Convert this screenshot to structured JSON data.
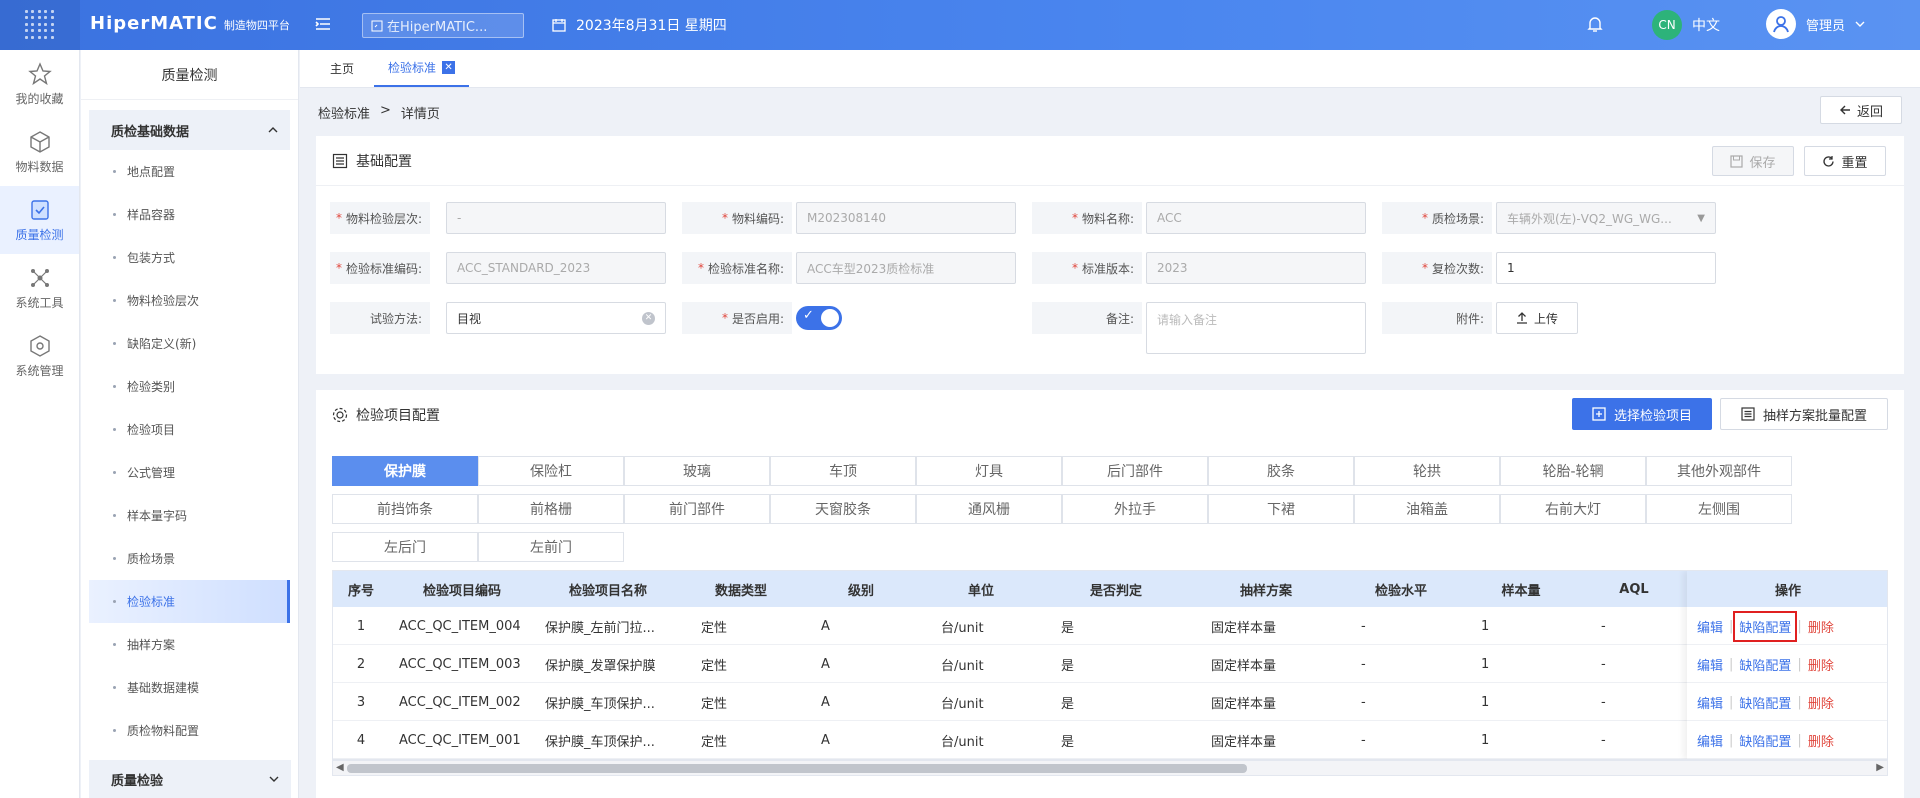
{
  "header": {
    "logo_text": "HiperMATIC",
    "logo_sub": "制造物四平台",
    "search_placeholder": "在HiperMATIC...",
    "date": "2023年8月31日 星期四",
    "lang_badge": "CN",
    "lang_label": "中文",
    "user_name": "管理员"
  },
  "rail": {
    "items": [
      {
        "label": "我的收藏",
        "icon": "star-icon"
      },
      {
        "label": "物料数据",
        "icon": "cube-icon"
      },
      {
        "label": "质量检测",
        "icon": "shield-check-icon"
      },
      {
        "label": "系统工具",
        "icon": "network-icon"
      },
      {
        "label": "系统管理",
        "icon": "gear-cube-icon"
      }
    ]
  },
  "sidebar": {
    "title": "质量检测",
    "group1": "质检基础数据",
    "items": [
      "地点配置",
      "样品容器",
      "包装方式",
      "物料检验层次",
      "缺陷定义(新)",
      "检验类别",
      "检验项目",
      "公式管理",
      "样本量字码",
      "质检场景",
      "检验标准",
      "抽样方案",
      "基础数据建模",
      "质检物料配置"
    ],
    "group2": "质量检验"
  },
  "tabs": {
    "home": "主页",
    "current": "检验标准"
  },
  "breadcrumb": {
    "parent": "检验标准",
    "sep": ">",
    "current": "详情页"
  },
  "back_label": "返回",
  "basic": {
    "title": "基础配置",
    "save_label": "保存",
    "reset_label": "重置",
    "fields": {
      "level_label": "物料检验层次:",
      "level_value": "-",
      "code_label": "物料编码:",
      "code_value": "M202308140",
      "name_label": "物料名称:",
      "name_value": "ACC",
      "scene_label": "质检场景:",
      "scene_value": "车辆外观(左)-VQ2_WG_WG...",
      "std_code_label": "检验标准编码:",
      "std_code_value": "ACC_STANDARD_2023",
      "std_name_label": "检验标准名称:",
      "std_name_value": "ACC车型2023质检标准",
      "version_label": "标准版本:",
      "version_value": "2023",
      "recheck_label": "复检次数:",
      "recheck_value": "1",
      "method_label": "试验方法:",
      "method_value": "目视",
      "enabled_label": "是否启用:",
      "remark_label": "备注:",
      "remark_placeholder": "请输入备注",
      "attach_label": "附件:",
      "upload_label": "上传"
    }
  },
  "items_config": {
    "title": "检验项目配置",
    "select_btn": "选择检验项目",
    "batch_btn": "抽样方案批量配置",
    "categories": [
      "保护膜",
      "保险杠",
      "玻璃",
      "车顶",
      "灯具",
      "后门部件",
      "胶条",
      "轮拱",
      "轮胎-轮辋",
      "其他外观部件",
      "前挡饰条",
      "前格栅",
      "前门部件",
      "天窗胶条",
      "通风栅",
      "外拉手",
      "下裙",
      "油箱盖",
      "右前大灯",
      "左侧围",
      "左后门",
      "左前门"
    ],
    "active_category": 0,
    "table": {
      "headers": [
        "序号",
        "检验项目编码",
        "检验项目名称",
        "数据类型",
        "级别",
        "单位",
        "是否判定",
        "抽样方案",
        "检验水平",
        "样本量",
        "AQL",
        "操作"
      ],
      "rows": [
        [
          "1",
          "ACC_QC_ITEM_004",
          "保护膜_左前门拉...",
          "定性",
          "A",
          "台/unit",
          "是",
          "固定样本量",
          "-",
          "1",
          "-"
        ],
        [
          "2",
          "ACC_QC_ITEM_003",
          "保护膜_发罩保护膜",
          "定性",
          "A",
          "台/unit",
          "是",
          "固定样本量",
          "-",
          "1",
          "-"
        ],
        [
          "3",
          "ACC_QC_ITEM_002",
          "保护膜_车顶保护...",
          "定性",
          "A",
          "台/unit",
          "是",
          "固定样本量",
          "-",
          "1",
          "-"
        ],
        [
          "4",
          "ACC_QC_ITEM_001",
          "保护膜_车顶保护...",
          "定性",
          "A",
          "台/unit",
          "是",
          "固定样本量",
          "-",
          "1",
          "-"
        ]
      ],
      "op_edit": "编辑",
      "op_defect": "缺陷配置",
      "op_delete": "删除"
    }
  },
  "colors": {
    "primary": "#3c72e8",
    "danger": "#e0453b",
    "header": "#4a86ef"
  }
}
